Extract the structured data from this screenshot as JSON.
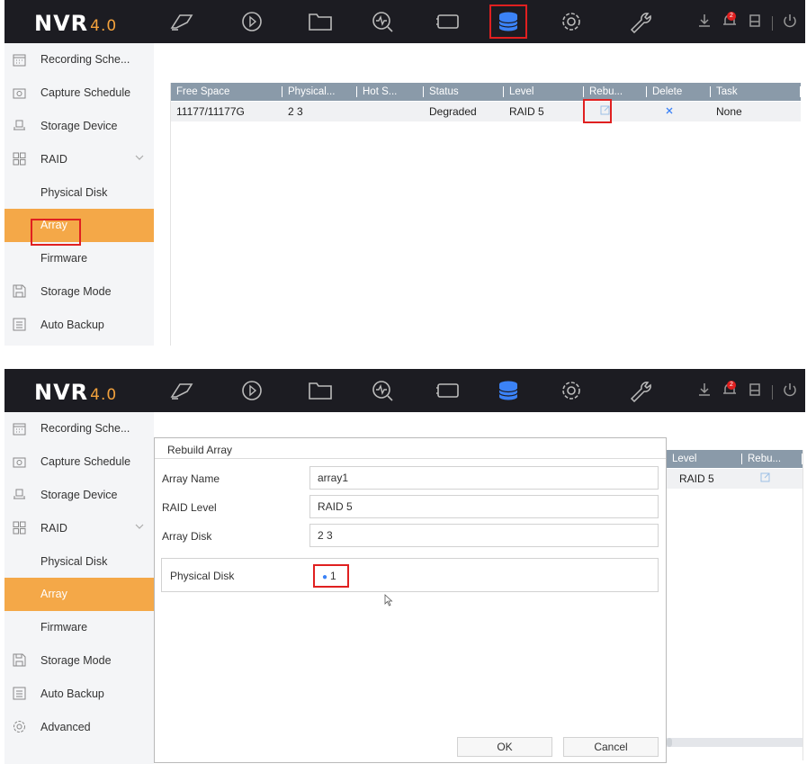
{
  "app": {
    "logo": "NVR",
    "version": "4.0"
  },
  "topbar": {
    "nav_icons": [
      "live-view-icon",
      "playback-icon",
      "file-management-icon",
      "smart-analysis-icon",
      "camera-icon",
      "storage-icon",
      "configuration-icon",
      "maintenance-icon"
    ],
    "right_icons": [
      "download-icon",
      "alarm-icon",
      "lock-icon",
      "power-icon"
    ],
    "alarm_count": "2"
  },
  "sidebar": {
    "items": [
      {
        "label": "Recording Sche...",
        "icon": "calendar-icon"
      },
      {
        "label": "Capture Schedule",
        "icon": "camera-capture-icon"
      },
      {
        "label": "Storage Device",
        "icon": "hdd-icon"
      },
      {
        "label": "RAID",
        "icon": "raid-icon"
      },
      {
        "label": "Physical Disk"
      },
      {
        "label": "Array"
      },
      {
        "label": "Firmware"
      },
      {
        "label": "Storage Mode",
        "icon": "save-icon"
      },
      {
        "label": "Auto Backup",
        "icon": "backup-icon"
      },
      {
        "label": "Advanced",
        "icon": "gear-icon"
      }
    ]
  },
  "array_table": {
    "headers": [
      "Free Space",
      "Physical...",
      "Hot S...",
      "Status",
      "Level",
      "Rebu...",
      "Delete",
      "Task"
    ],
    "row": {
      "free_space": "11177/11177G",
      "physical": "2 3",
      "hot_spare": "",
      "status": "Degraded",
      "level": "RAID 5",
      "task": "None"
    }
  },
  "dialog": {
    "title": "Rebuild Array",
    "array_name_label": "Array Name",
    "array_name_value": "array1",
    "raid_level_label": "RAID Level",
    "raid_level_value": "RAID 5",
    "array_disk_label": "Array Disk",
    "array_disk_value": "2 3",
    "physical_disk_label": "Physical Disk",
    "physical_disk_option": "1",
    "ok_label": "OK",
    "cancel_label": "Cancel"
  },
  "background_table": {
    "headers": [
      "Level",
      "Rebu..."
    ],
    "level_value": "RAID 5"
  },
  "colors": {
    "topbar": "#1c1c22",
    "accent_orange": "#f4a848",
    "highlight_red": "#e02020",
    "active_blue": "#3b82f6",
    "table_header": "#8a9aa9"
  }
}
